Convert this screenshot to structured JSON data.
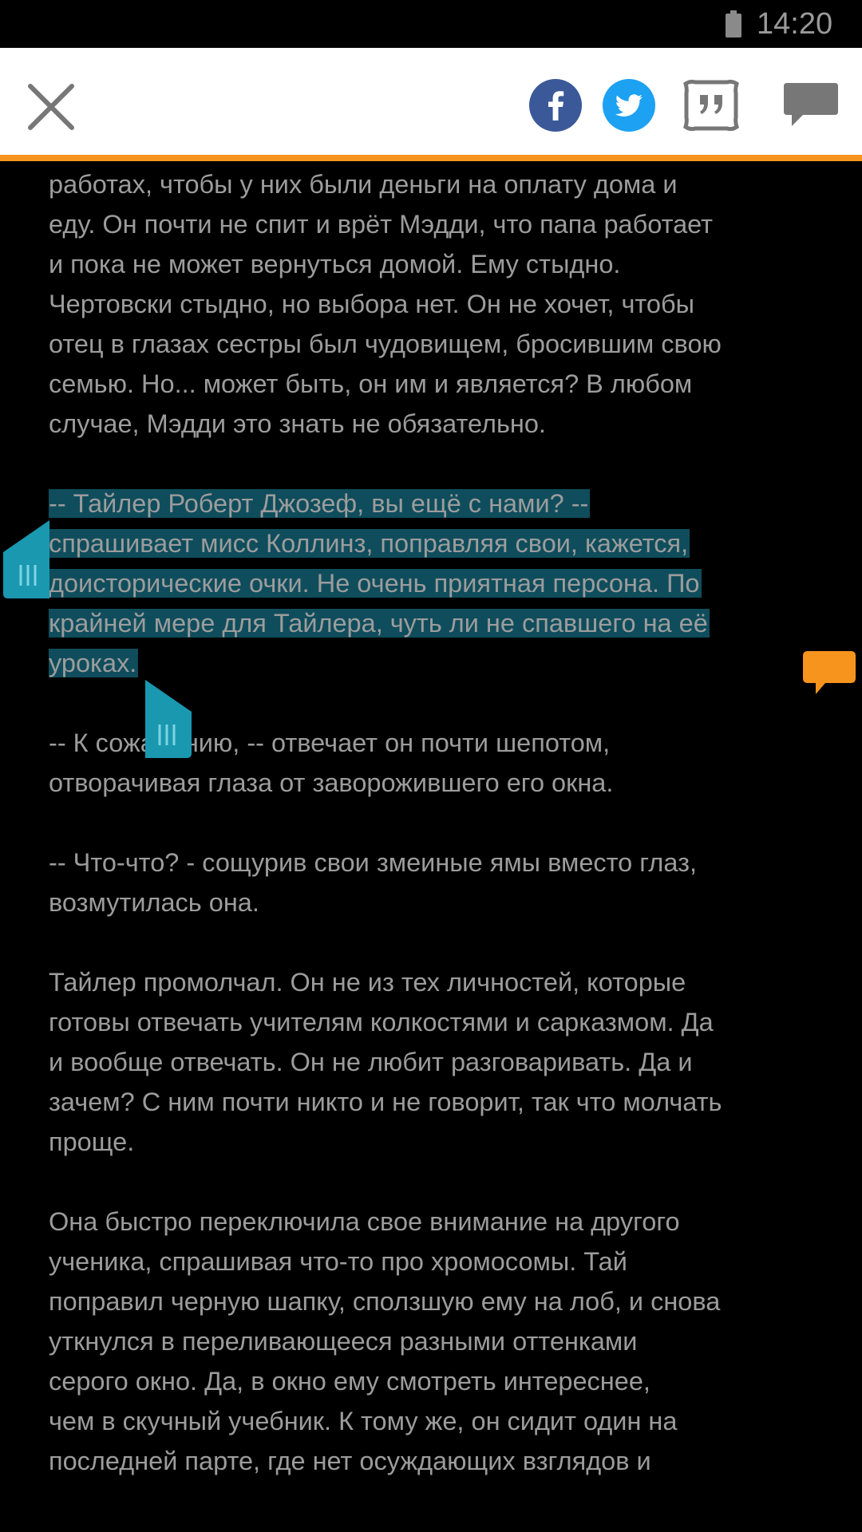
{
  "status_bar": {
    "time": "14:20",
    "battery_icon": "battery-icon"
  },
  "toolbar": {
    "close_icon": "close-icon",
    "facebook_icon": "facebook-icon",
    "twitter_icon": "twitter-icon",
    "quote_icon": "quote-icon",
    "comment_icon": "comment-icon",
    "colors": {
      "accent": "#f7941d",
      "facebook": "#3b5998",
      "twitter": "#1da1f2",
      "icon_gray": "#777777"
    }
  },
  "reader": {
    "lines": [
      {
        "text": "работах, чтобы у них были деньги на оплату дома и",
        "selected": false
      },
      {
        "text": "еду. Он почти не спит и врёт Мэдди, что папа работает",
        "selected": false
      },
      {
        "text": "и пока не может вернуться домой. Ему стыдно.",
        "selected": false
      },
      {
        "text": "Чертовски стыдно, но выбора нет. Он не хочет, чтобы",
        "selected": false
      },
      {
        "text": "отец в глазах сестры был чудовищем, бросившим свою",
        "selected": false
      },
      {
        "text": "семью. Но... может быть, он им и является? В любом",
        "selected": false
      },
      {
        "text": "случае, Мэдди это знать не обязательно.",
        "selected": false
      },
      {
        "text": "",
        "selected": false
      },
      {
        "text": "-- Тайлер Роберт Джозеф, вы ещё с нами? --",
        "selected": true
      },
      {
        "text": "спрашивает мисс Коллинз, поправляя свои, кажется,",
        "selected": true
      },
      {
        "text": "доисторические очки. Не очень приятная персона. По",
        "selected": true
      },
      {
        "text": "крайней мере для Тайлера, чуть ли не спавшего на её",
        "selected": true
      },
      {
        "text": "уроках.",
        "selected": true
      },
      {
        "text": "",
        "selected": false
      },
      {
        "text": "-- К сожалению, -- отвечает он почти шепотом,",
        "selected": false
      },
      {
        "text": "отворачивая глаза от заворожившего его окна.",
        "selected": false
      },
      {
        "text": "",
        "selected": false
      },
      {
        "text": "-- Что-что? - сощурив свои змеиные ямы вместо глаз,",
        "selected": false
      },
      {
        "text": "возмутилась она.",
        "selected": false
      },
      {
        "text": "",
        "selected": false
      },
      {
        "text": "Тайлер промолчал. Он не из тех личностей, которые",
        "selected": false
      },
      {
        "text": "готовы отвечать учителям колкостями и сарказмом. Да",
        "selected": false
      },
      {
        "text": "и вообще отвечать. Он не любит разговаривать. Да и",
        "selected": false
      },
      {
        "text": "зачем? С ним почти никто и не говорит, так что молчать",
        "selected": false
      },
      {
        "text": "проще.",
        "selected": false
      },
      {
        "text": "",
        "selected": false
      },
      {
        "text": "Она быстро переключила свое внимание на другого",
        "selected": false
      },
      {
        "text": "ученика, спрашивая что-то про хромосомы. Тай",
        "selected": false
      },
      {
        "text": "поправил черную шапку, сползшую ему на лоб, и снова",
        "selected": false
      },
      {
        "text": "уткнулся в переливающееся разными оттенками",
        "selected": false
      },
      {
        "text": "серого окно. Да, в окно ему смотреть интереснее,",
        "selected": false
      },
      {
        "text": "чем в скучный учебник. К тому же, он сидит один на",
        "selected": false
      },
      {
        "text": "последней парте, где нет осуждающих взглядов и",
        "selected": false
      }
    ],
    "selection_color": "#0f4d5c",
    "handle_color": "#1a98b0",
    "text_color": "#9c9c9c"
  },
  "floating": {
    "comment_marker_icon": "comment-bubble-icon",
    "marker_color": "#f7941d"
  }
}
